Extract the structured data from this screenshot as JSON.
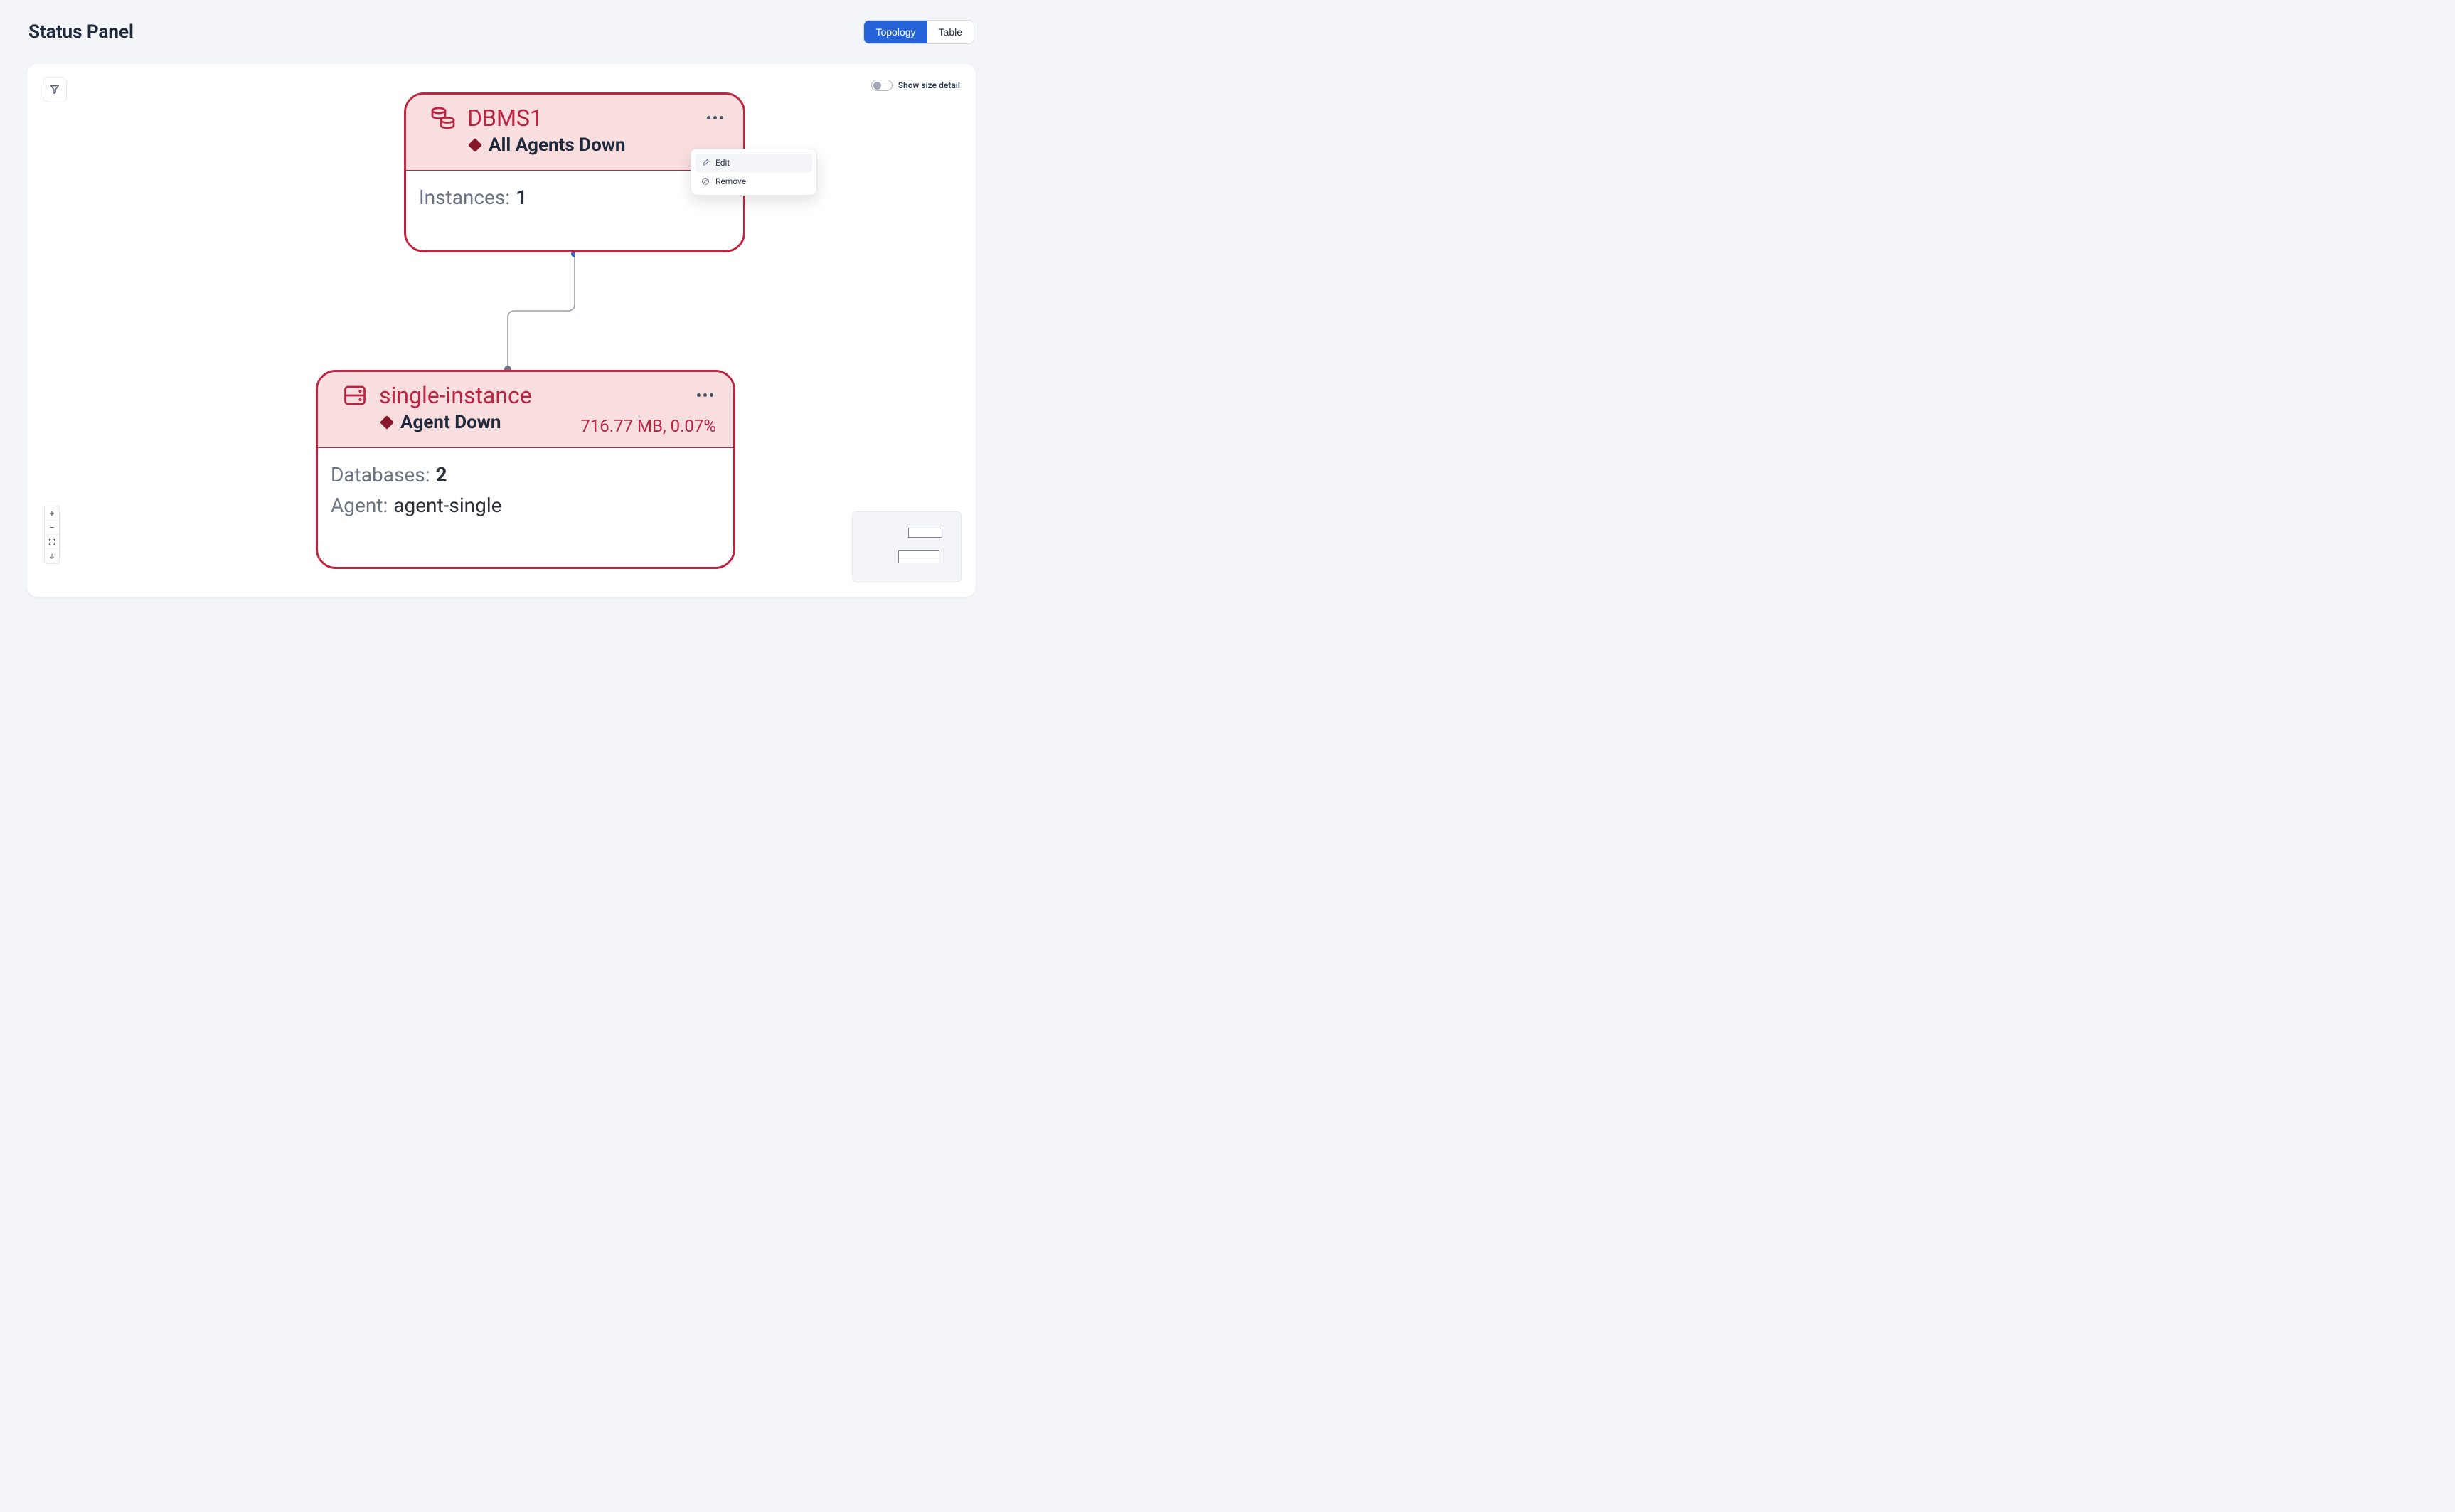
{
  "header": {
    "title": "Status Panel",
    "view_toggle": {
      "topology": "Topology",
      "table": "Table",
      "active": "topology"
    }
  },
  "panel": {
    "size_toggle_label": "Show size detail"
  },
  "context_menu": {
    "edit": "Edit",
    "remove": "Remove"
  },
  "nodes": {
    "dbms": {
      "title": "DBMS1",
      "status": "All Agents Down",
      "instances_label": "Instances:",
      "instances_value": "1"
    },
    "instance": {
      "title": "single-instance",
      "status": "Agent Down",
      "size_text": "716.77 MB, 0.07%",
      "databases_label": "Databases:",
      "databases_value": "2",
      "agent_label": "Agent:",
      "agent_value": "agent-single"
    }
  }
}
